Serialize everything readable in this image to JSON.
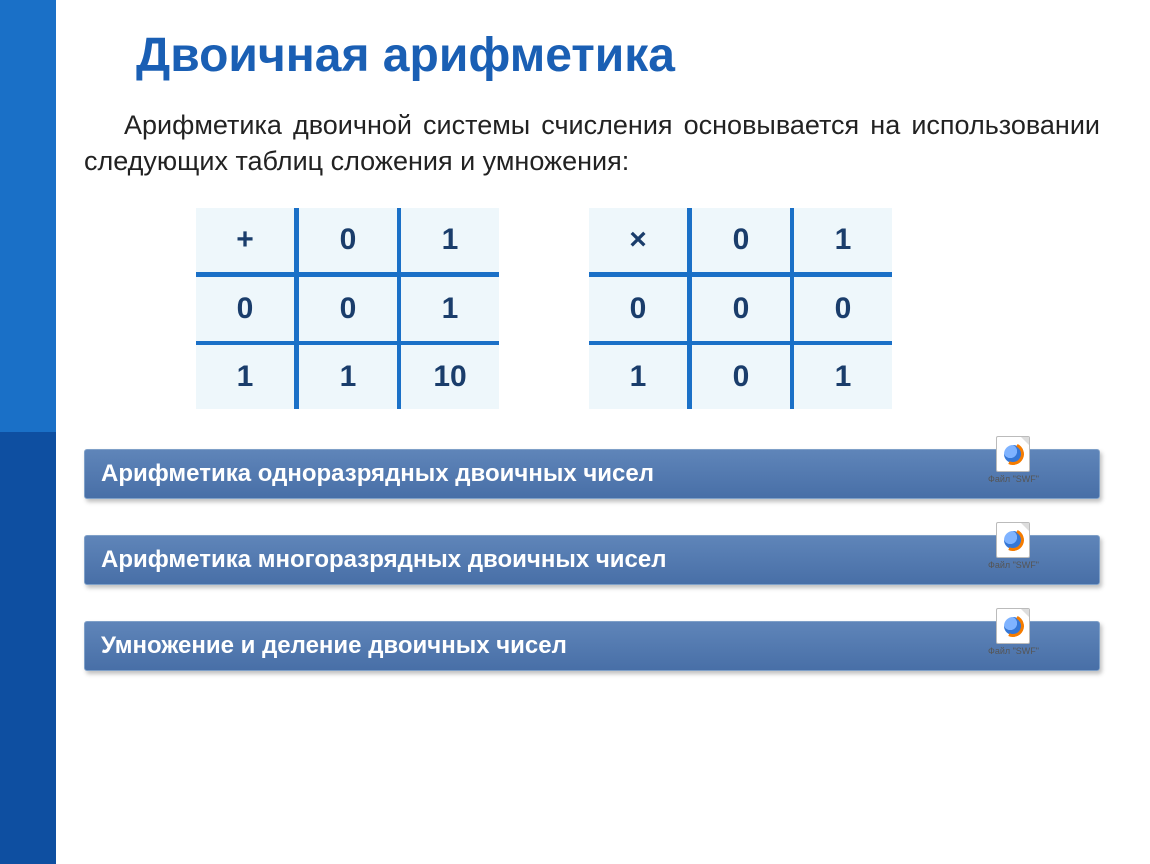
{
  "title": "Двоичная арифметика",
  "description": "Арифметика двоичной системы счисления основывается на использовании следующих таблиц сложения и умножения:",
  "addTable": {
    "op": "+",
    "headers": [
      "0",
      "1"
    ],
    "rows": [
      {
        "label": "0",
        "cells": [
          "0",
          "1"
        ]
      },
      {
        "label": "1",
        "cells": [
          "1",
          "10"
        ]
      }
    ]
  },
  "mulTable": {
    "op": "×",
    "headers": [
      "0",
      "1"
    ],
    "rows": [
      {
        "label": "0",
        "cells": [
          "0",
          "0"
        ]
      },
      {
        "label": "1",
        "cells": [
          "0",
          "1"
        ]
      }
    ]
  },
  "links": [
    {
      "label": "Арифметика одноразрядных двоичных чисел",
      "file": "Файл \"SWF\""
    },
    {
      "label": "Арифметика многоразрядных двоичных чисел",
      "file": "Файл \"SWF\""
    },
    {
      "label": "Умножение и деление двоичных чисел",
      "file": "Файл \"SWF\""
    }
  ]
}
